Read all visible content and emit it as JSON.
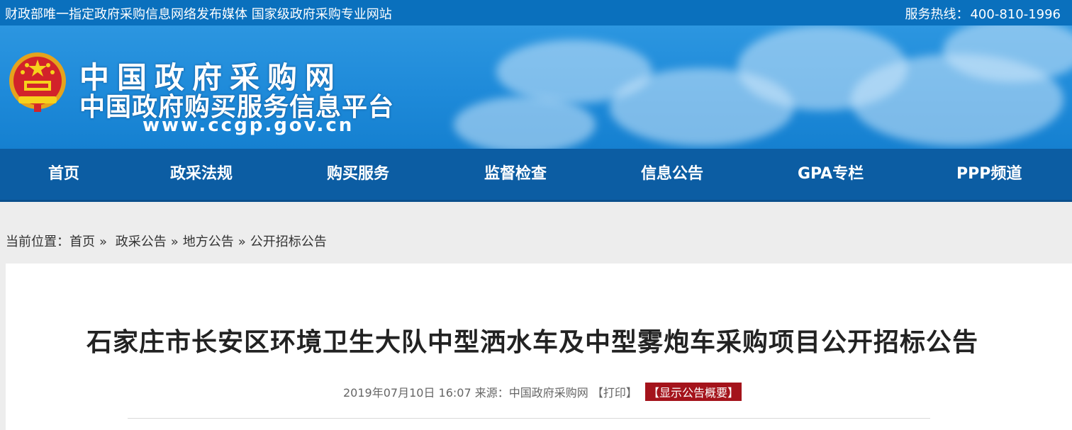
{
  "topbar": {
    "slogan": "财政部唯一指定政府采购信息网络发布媒体 国家级政府采购专业网站",
    "hotline_label": "服务热线：",
    "hotline_number": "400-810-1996"
  },
  "header": {
    "title": "中国政府采购网",
    "subtitle": "中国政府购买服务信息平台",
    "url": "www.ccgp.gov.cn",
    "emblem_icon": "national-emblem-icon"
  },
  "nav": {
    "items": [
      {
        "label": "首页"
      },
      {
        "label": "政采法规"
      },
      {
        "label": "购买服务"
      },
      {
        "label": "监督检查"
      },
      {
        "label": "信息公告"
      },
      {
        "label": "GPA专栏"
      },
      {
        "label": "PPP频道"
      }
    ]
  },
  "breadcrumb": {
    "prefix": "当前位置：",
    "items": [
      "首页",
      "政采公告",
      "地方公告",
      "公开招标公告"
    ],
    "separator": "»"
  },
  "article": {
    "title": "石家庄市长安区环境卫生大队中型洒水车及中型雾炮车采购项目公开招标公告",
    "datetime": "2019年07月10日 16:07",
    "source_label": "来源：",
    "source": "中国政府采购网",
    "print_label": "【打印】",
    "summary_label": "【显示公告概要】"
  },
  "colors": {
    "topbar": "#0a70bd",
    "nav": "#0c5da3",
    "summary_button": "#a4131b"
  }
}
